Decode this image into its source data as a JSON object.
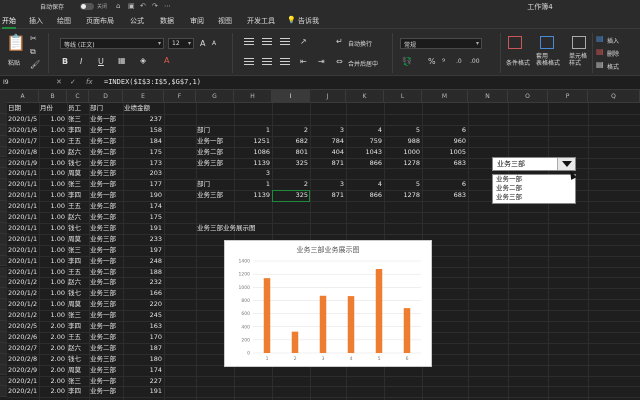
{
  "titlebar": {
    "autosave_label": "自动保存",
    "autosave_state": "关闭",
    "doc_title": "工作簿4"
  },
  "tabs": [
    {
      "label": "开始",
      "active": true
    },
    {
      "label": "插入"
    },
    {
      "label": "绘图"
    },
    {
      "label": "页面布局"
    },
    {
      "label": "公式"
    },
    {
      "label": "数据"
    },
    {
      "label": "审阅"
    },
    {
      "label": "视图"
    },
    {
      "label": "开发工具"
    },
    {
      "label": "告诉我"
    }
  ],
  "ribbon": {
    "paste_label": "粘贴",
    "font_name": "等线 (正文)",
    "font_size": "12",
    "wrap_label": "自动换行",
    "merge_label": "合并后居中",
    "number_format": "常规",
    "cond_format_label": "条件格式",
    "table_format_label": "套用\n表格格式",
    "cell_style_label": "单元格\n样式",
    "insert_label": "插入",
    "delete_label": "删除",
    "format_label": "格式",
    "bold": "B",
    "italic": "I",
    "underline": "U",
    "grow_font": "A",
    "shrink_font": "A"
  },
  "formula_bar": {
    "name_box": "I9",
    "fx": "fx",
    "formula": "=INDEX($I$3:I$5,$G$7,1)"
  },
  "columns": [
    "A",
    "B",
    "C",
    "D",
    "E",
    "F",
    "G",
    "H",
    "I",
    "J",
    "K",
    "L",
    "M",
    "N",
    "O",
    "P",
    "Q"
  ],
  "table_left": {
    "headers": [
      "日期",
      "月份",
      "员工",
      "部门",
      "业绩金额"
    ],
    "rows": [
      [
        "2020/1/5",
        "1.00",
        "张三",
        "业务一部",
        "237"
      ],
      [
        "2020/1/6",
        "1.00",
        "李四",
        "业务一部",
        "158"
      ],
      [
        "2020/1/7",
        "1.00",
        "王五",
        "业务二部",
        "184"
      ],
      [
        "2020/1/8",
        "1.00",
        "赵六",
        "业务二部",
        "175"
      ],
      [
        "2020/1/9",
        "1.00",
        "钱七",
        "业务三部",
        "173"
      ],
      [
        "2020/1/10",
        "1.00",
        "周莫",
        "业务三部",
        "203"
      ],
      [
        "2020/1/11",
        "1.00",
        "张三",
        "业务一部",
        "177"
      ],
      [
        "2020/1/12",
        "1.00",
        "李四",
        "业务一部",
        "190"
      ],
      [
        "2020/1/13",
        "1.00",
        "王五",
        "业务二部",
        "174"
      ],
      [
        "2020/1/14",
        "1.00",
        "赵六",
        "业务二部",
        "175"
      ],
      [
        "2020/1/15",
        "1.00",
        "钱七",
        "业务三部",
        "191"
      ],
      [
        "2020/1/16",
        "1.00",
        "周莫",
        "业务三部",
        "233"
      ],
      [
        "2020/1/17",
        "1.00",
        "张三",
        "业务一部",
        "197"
      ],
      [
        "2020/1/18",
        "1.00",
        "李四",
        "业务一部",
        "248"
      ],
      [
        "2020/1/19",
        "1.00",
        "王五",
        "业务二部",
        "188"
      ],
      [
        "2020/1/20",
        "1.00",
        "赵六",
        "业务二部",
        "232"
      ],
      [
        "2020/1/21",
        "1.00",
        "钱七",
        "业务三部",
        "166"
      ],
      [
        "2020/1/22",
        "1.00",
        "周莫",
        "业务三部",
        "220"
      ],
      [
        "2020/1/23",
        "1.00",
        "张三",
        "业务一部",
        "245"
      ],
      [
        "2020/2/5",
        "2.00",
        "李四",
        "业务一部",
        "163"
      ],
      [
        "2020/2/6",
        "2.00",
        "王五",
        "业务二部",
        "170"
      ],
      [
        "2020/2/7",
        "2.00",
        "赵六",
        "业务二部",
        "187"
      ],
      [
        "2020/2/8",
        "2.00",
        "钱七",
        "业务三部",
        "180"
      ],
      [
        "2020/2/9",
        "2.00",
        "周莫",
        "业务三部",
        "174"
      ],
      [
        "2020/2/10",
        "2.00",
        "张三",
        "业务一部",
        "227"
      ],
      [
        "2020/2/11",
        "2.00",
        "李四",
        "业务一部",
        "191"
      ],
      [
        "2020/2/12",
        "2.00",
        "王五",
        "业务二部",
        "227"
      ],
      [
        "2020/2/13",
        "2.00",
        "赵六",
        "业务二部",
        "189"
      ],
      [
        "2020/3/6",
        "3.00",
        "钱七",
        "业务三部",
        "184"
      ],
      [
        "2020/3/7",
        "3.00",
        "周莫",
        "业务三部",
        "180"
      ]
    ]
  },
  "table_top": {
    "header": [
      "部门",
      "1",
      "2",
      "3",
      "4",
      "5",
      "6"
    ],
    "rows": [
      [
        "业务一部",
        "1251",
        "682",
        "784",
        "759",
        "988",
        "960"
      ],
      [
        "业务二部",
        "1086",
        "801",
        "404",
        "1043",
        "1000",
        "1005"
      ],
      [
        "业务三部",
        "1139",
        "325",
        "871",
        "866",
        "1278",
        "683"
      ]
    ]
  },
  "selector_index": "3",
  "table_mid": {
    "header": [
      "部门",
      "1",
      "2",
      "3",
      "4",
      "5",
      "6"
    ],
    "row": [
      "业务三部",
      "1139",
      "325",
      "871",
      "866",
      "1278",
      "683"
    ]
  },
  "chart_caption": "业务三部业务展示图",
  "dropdown": {
    "selected": "业务三部",
    "options": [
      "业务一部",
      "业务二部",
      "业务三部"
    ]
  },
  "chart_data": {
    "type": "bar",
    "title": "业务三部业务展示图",
    "categories": [
      "1",
      "2",
      "3",
      "4",
      "5",
      "6"
    ],
    "values": [
      1139,
      325,
      871,
      866,
      1278,
      683
    ],
    "ylim": [
      0,
      1400
    ],
    "yticks": [
      "0",
      "200",
      "400",
      "600",
      "800",
      "1000",
      "1200",
      "1400"
    ],
    "bar_color": "#ed7d31",
    "grid": true,
    "legend": "none"
  },
  "colors": {
    "accent": "#1f8a3c",
    "bar": "#ed7d31"
  }
}
